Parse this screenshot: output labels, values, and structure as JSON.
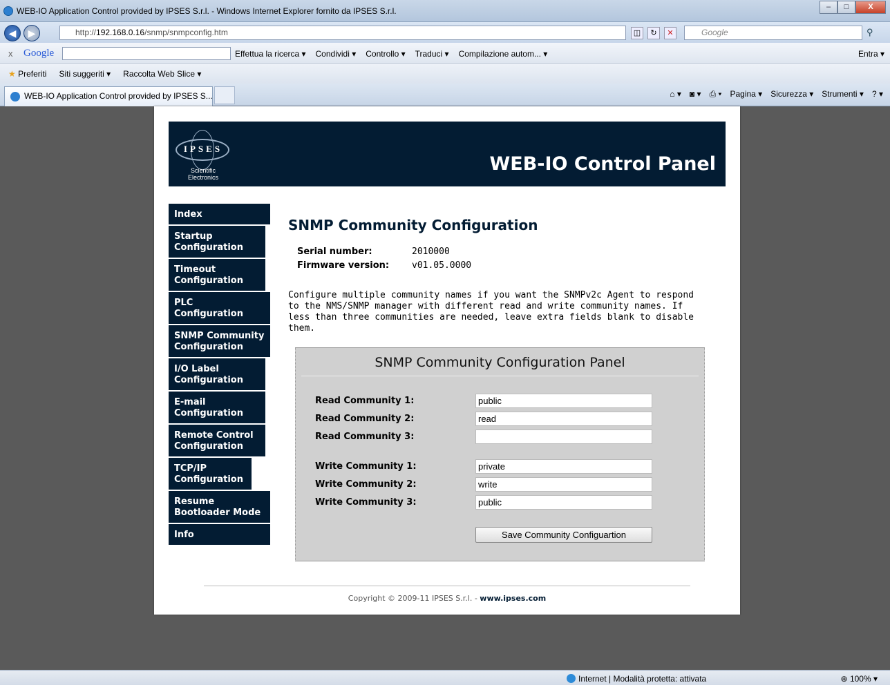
{
  "window": {
    "title": "WEB-IO Application Control provided by IPSES S.r.l. - Windows Internet Explorer fornito da IPSES S.r.l.",
    "minimize": "–",
    "maximize": "□",
    "close": "X"
  },
  "address": {
    "url_prefix": "http://",
    "url_host": "192.168.0.16",
    "url_path": "/snmp/snmpconfig.htm",
    "search_placeholder": "Google"
  },
  "googlebar": {
    "close": "x",
    "logo": "Google",
    "items": [
      "Effettua la ricerca ▾",
      "Condividi ▾",
      "Controllo ▾",
      "Traduci ▾",
      "Compilazione autom... ▾"
    ],
    "signin": "Entra ▾"
  },
  "favorites": {
    "label": "Preferiti",
    "items": [
      "Siti suggeriti ▾",
      "Raccolta Web Slice ▾"
    ]
  },
  "tabs": {
    "active": "WEB-IO Application Control provided by IPSES S....",
    "commands": [
      "Pagina ▾",
      "Sicurezza ▾",
      "Strumenti ▾"
    ]
  },
  "page": {
    "banner_title": "WEB-IO Control Panel",
    "logo_text": "IPSES",
    "logo_sub1": "Scientific",
    "logo_sub2": "Electronics",
    "menu": [
      "Index",
      "Startup Configuration",
      "Timeout Configuration",
      "PLC Configuration",
      "SNMP Community Configuration",
      "I/O Label Configuration",
      "E-mail Configuration",
      "Remote Control Configuration",
      "TCP/IP Configuration",
      "Resume Bootloader Mode",
      "Info"
    ],
    "heading": "SNMP Community Configuration",
    "serial_label": "Serial number:",
    "serial_value": "2010000",
    "firmware_label": "Firmware version:",
    "firmware_value": "v01.05.0000",
    "description": "Configure multiple community names if you want the SNMPv2c Agent to respond to the NMS/SNMP manager with different read and write community names. If less than three communities are needed, leave extra fields blank to disable them.",
    "panel_title": "SNMP Community Configuration Panel",
    "fields": [
      {
        "label": "Read Community 1:",
        "value": "public"
      },
      {
        "label": "Read Community 2:",
        "value": "read"
      },
      {
        "label": "Read Community 3:",
        "value": ""
      },
      {
        "label": "Write Community 1:",
        "value": "private"
      },
      {
        "label": "Write Community 2:",
        "value": "write"
      },
      {
        "label": "Write Community 3:",
        "value": "public"
      }
    ],
    "save_button": "Save Community Configuartion",
    "copyright_text": "Copyright © 2009-11 IPSES S.r.l. - ",
    "copyright_link": "www.ipses.com"
  },
  "status": {
    "zone": "Internet | Modalità protetta: attivata",
    "zoom": "100%"
  },
  "colors": {
    "navy": "#031c33",
    "panel": "#d0d0d0"
  }
}
